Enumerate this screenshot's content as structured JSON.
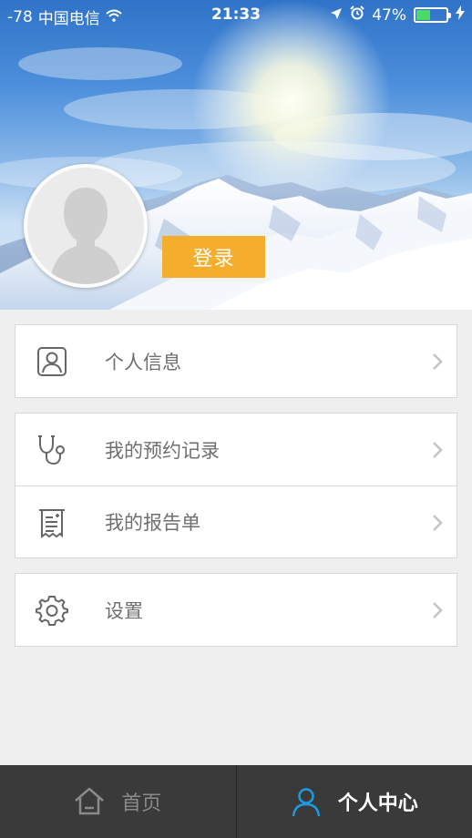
{
  "status_bar": {
    "signal": "-78",
    "carrier": "中国电信",
    "time": "21:33",
    "battery_text": "47%",
    "battery_level": 0.47,
    "icons": [
      "wifi-icon",
      "location-arrow-icon",
      "alarm-icon",
      "battery-icon",
      "charging-bolt-icon"
    ]
  },
  "header": {
    "login_label": "登录"
  },
  "menu": {
    "personal_info": {
      "label": "个人信息",
      "icon": "user-card-icon"
    },
    "appointments": {
      "label": "我的预约记录",
      "icon": "stethoscope-icon"
    },
    "reports": {
      "label": "我的报告单",
      "icon": "receipt-icon"
    },
    "settings": {
      "label": "设置",
      "icon": "gear-icon"
    }
  },
  "tabbar": {
    "home": {
      "label": "首页",
      "icon": "home-icon"
    },
    "profile": {
      "label": "个人中心",
      "icon": "person-icon",
      "active": true
    }
  },
  "colors": {
    "accent": "#f5ad2c",
    "active_tab_icon": "#1e9be0",
    "tabbar_bg": "#3a3a3a",
    "page_bg": "#efeff0"
  }
}
